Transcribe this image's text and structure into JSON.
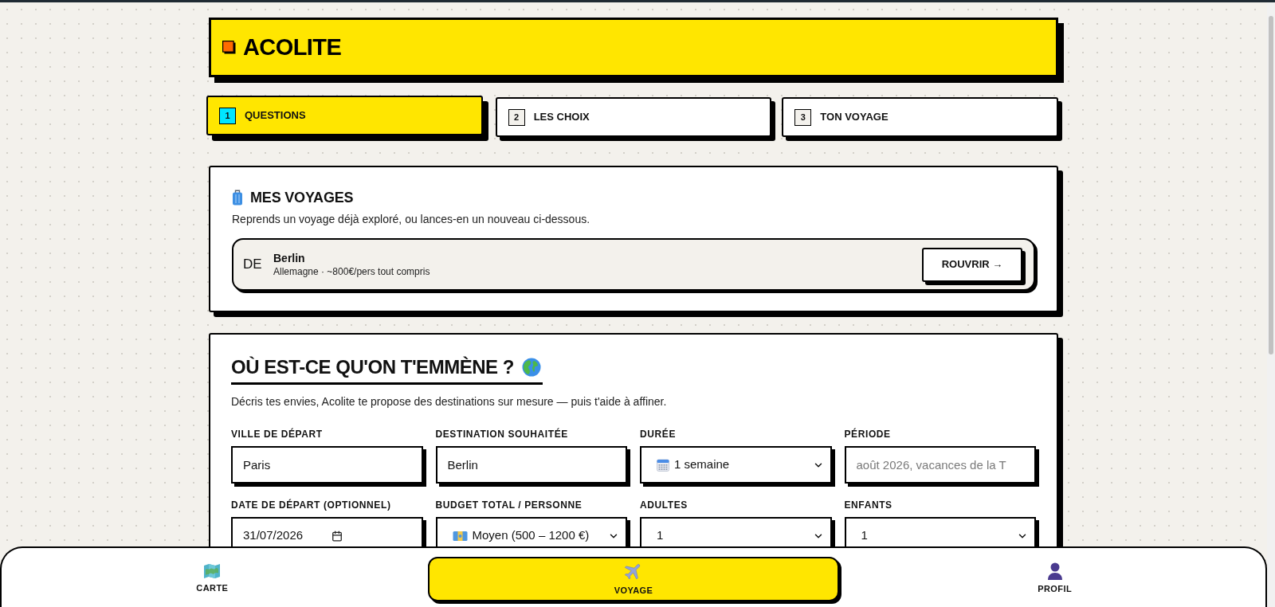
{
  "header": {
    "title": "ACOLITE"
  },
  "steps": [
    {
      "number": "1",
      "label": "QUESTIONS",
      "selected": true
    },
    {
      "number": "2",
      "label": "LES CHOIX",
      "selected": false
    },
    {
      "number": "3",
      "label": "TON VOYAGE",
      "selected": false
    }
  ],
  "my_trips": {
    "title": "MES VOYAGES",
    "description": "Reprends un voyage déjà exploré, ou lances-en un nouveau ci-dessous.",
    "trips": [
      {
        "country_code": "DE",
        "city": "Berlin",
        "details": "Allemagne · ~800€/pers tout compris",
        "action": "ROUVRIR →"
      }
    ]
  },
  "trip_form": {
    "title": "OÙ EST-CE QU'ON T'EMMÈNE ?",
    "description": "Décris tes envies, Acolite te propose des destinations sur mesure — puis t'aide à affiner.",
    "fields": [
      {
        "label": "VILLE DE DÉPART",
        "kind": "text",
        "value": "Paris"
      },
      {
        "label": "DESTINATION SOUHAITÉE",
        "kind": "text",
        "value": "Berlin"
      },
      {
        "label": "DURÉE",
        "kind": "select",
        "value": "1 semaine"
      },
      {
        "label": "PÉRIODE",
        "kind": "text",
        "placeholder": "août 2026, vacances de la T"
      },
      {
        "label": "DATE DE DÉPART (OPTIONNEL)",
        "kind": "date",
        "value": "31/07/2026"
      },
      {
        "label": "BUDGET TOTAL / PERSONNE",
        "kind": "select",
        "value": "Moyen (500 – 1200 €)"
      },
      {
        "label": "ADULTES",
        "kind": "select",
        "value": "1"
      },
      {
        "label": "ENFANTS",
        "kind": "select",
        "value": "1"
      }
    ]
  },
  "bottom_nav": [
    {
      "label": "CARTE",
      "selected": false
    },
    {
      "label": "VOYAGE",
      "selected": true
    },
    {
      "label": "PROFIL",
      "selected": false
    }
  ]
}
